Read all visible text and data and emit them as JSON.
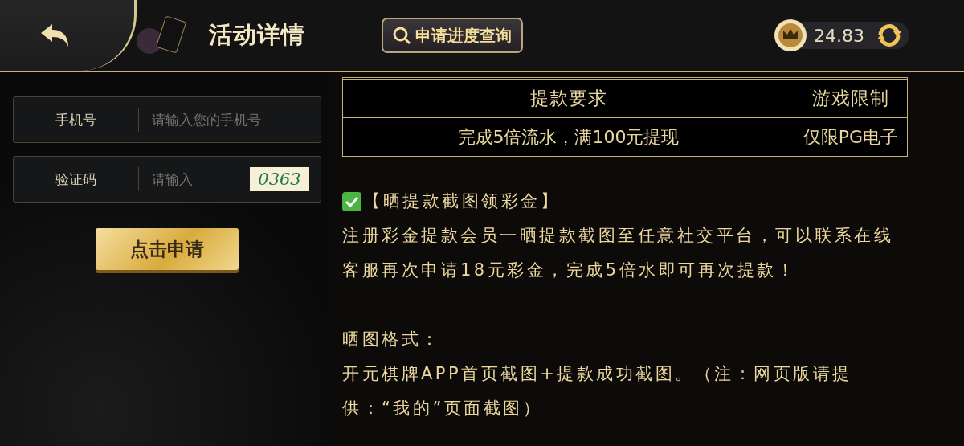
{
  "header": {
    "title": "活动详情",
    "query_button": "申请进度查询",
    "balance": "24.83"
  },
  "form": {
    "fields": [
      {
        "label": "手机号",
        "placeholder": "请输入您的手机号",
        "kind": "text"
      },
      {
        "label": "验证码",
        "placeholder": "请输入",
        "kind": "captcha",
        "captcha": "0363"
      }
    ],
    "submit": "点击申请"
  },
  "table": {
    "columns": [
      "提款要求",
      "游戏限制"
    ],
    "rows": [
      [
        "完成5倍流水，满100元提现",
        "仅限PG电子"
      ]
    ]
  },
  "content": {
    "heading": "【晒提款截图领彩金】",
    "blocks": [
      {
        "kind": "text",
        "text": "注册彩金提款会员一晒提款截图至任意社交平台，可以联系在线客服再次申请18元彩金，完成5倍水即可再次提款！"
      },
      {
        "kind": "gap"
      },
      {
        "kind": "text",
        "text": "晒图格式："
      },
      {
        "kind": "text",
        "text": "开元棋牌APP首页截图+提款成功截图。（注：网页版请提供：“我的”页面截图）"
      }
    ]
  }
}
